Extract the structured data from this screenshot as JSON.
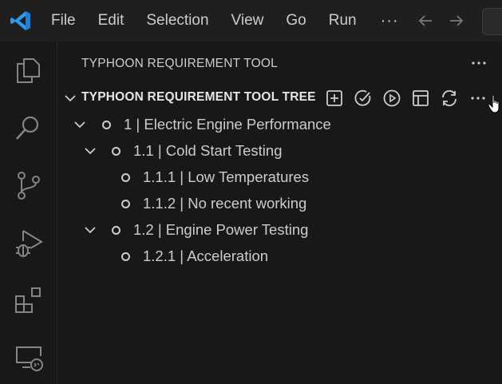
{
  "menubar": {
    "items": [
      "File",
      "Edit",
      "Selection",
      "View",
      "Go",
      "Run"
    ],
    "more": "···"
  },
  "sidebar": {
    "title": "TYPHOON REQUIREMENT TOOL",
    "section_title": "TYPHOON REQUIREMENT TOOL TREE"
  },
  "tree": [
    {
      "id": "n1",
      "label": "1 | Electric Engine Performance"
    },
    {
      "id": "n1_1",
      "label": "1.1 | Cold Start Testing"
    },
    {
      "id": "n1_1_1",
      "label": "1.1.1 | Low Temperatures"
    },
    {
      "id": "n1_1_2",
      "label": "1.1.2 | No recent working"
    },
    {
      "id": "n1_2",
      "label": "1.2 | Engine Power Testing"
    },
    {
      "id": "n1_2_1",
      "label": "1.2.1 | Acceleration"
    }
  ],
  "icons": {
    "logo": "vscode-logo",
    "activity": [
      "explorer-icon",
      "search-icon",
      "source-control-icon",
      "run-debug-icon",
      "extensions-icon",
      "remote-explorer-icon"
    ],
    "toolbar": [
      "add-icon",
      "check-circle-icon",
      "play-circle-icon",
      "table-icon",
      "refresh-icon",
      "more-icon"
    ]
  },
  "colors": {
    "background": "#181818",
    "titlebar": "#1f1f1f",
    "accent": "#0078d4",
    "text": "#cccccc"
  }
}
